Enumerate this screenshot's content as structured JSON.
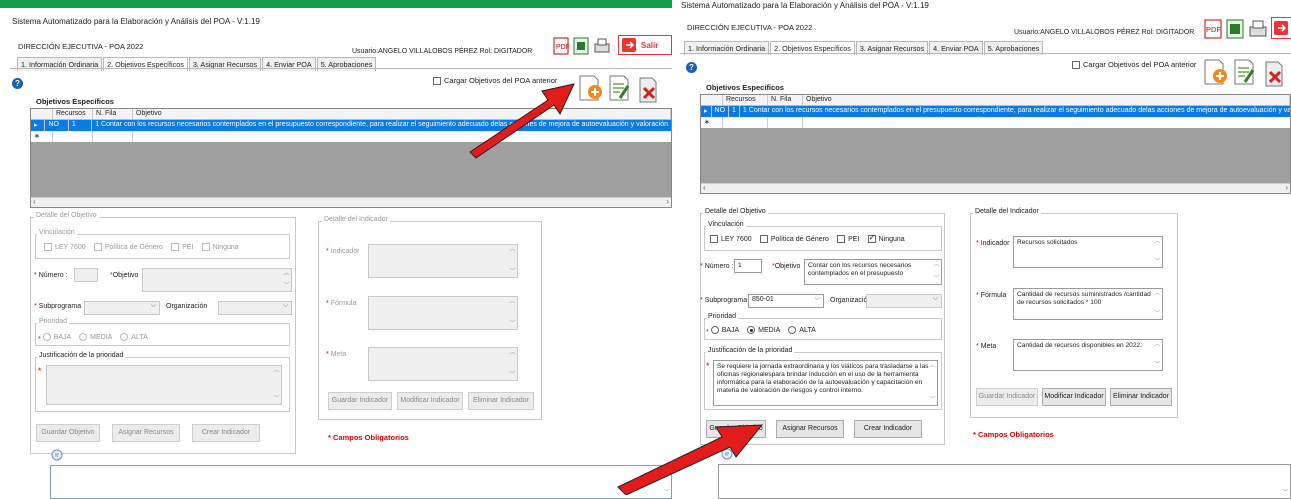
{
  "window_title": "Sistema Automatizado para la Elaboración y Análisis del POA -  V:1.19",
  "header": {
    "direccion": "DIRECCIÓN EJECUTIVA - POA 2022",
    "usuario": "Usuario:ANGELO VILLALOBOS PÉREZ  Rol: DIGITADOR",
    "salir": "Salir"
  },
  "tabs": [
    "1. Información Ordinaria",
    "2. Objetivos Específicos",
    "3. Asignar Recursos",
    "4. Enviar POA",
    "5. Aprobaciones"
  ],
  "cargar_label": "Cargar Objetivos del POA anterior",
  "objetivos_title": "Objetivos Específicos",
  "grid": {
    "columns": [
      "Recursos",
      "N. Fila",
      "Objetivo"
    ],
    "row": {
      "recursos": "NO",
      "fila": "1",
      "objetivo": "1 Contar con los recursos necesarios contemplados en el presupuesto correspondiente, para realizar el seguimiento adecuado delas acciones de mejora de autoevaluación y valoración"
    }
  },
  "detalle_objetivo": {
    "legend": "Detalle del Objetivo",
    "vinculacion": "Vinculación",
    "options": [
      "LEY 7600",
      "Política de Género",
      "PEI",
      "Ninguna"
    ],
    "numero_label": "Número :",
    "objetivo_label": "Objetivo",
    "subprograma_label": "Subprograma",
    "organizacion_label": "Organización",
    "prioridad_legend": "Prioridad",
    "prioridades": [
      "BAJA",
      "MEDIA",
      "ALTA"
    ],
    "justificacion_legend": "Justificación de la prioridad"
  },
  "detalle_indicador": {
    "legend": "Detalle del Indicador",
    "indicador_label": "Indicador",
    "formula_label": "Fórmula",
    "meta_label": "Meta"
  },
  "buttons": {
    "guardar_indicador": "Guardar Indicador",
    "modificar_indicador": "Modificar Indicador",
    "eliminar_indicador": "Eliminar Indicador",
    "guardar_objetivo": "Guardar Objetivo",
    "asignar_recursos": "Asignar Recursos",
    "crear_indicador": "Crear Indicador"
  },
  "campos_obligatorios": "* Campos Obligatorios",
  "right_values": {
    "numero": "1",
    "objetivo": "Contar con los recursos necesarios contemplados en el presupuesto",
    "subprograma": "850-01",
    "justificacion": "Se requiere la jornada extraordinaria y los viáticos para trasladarse a las oficinas regionalespara brindar inducción en el uso de la herramienta informática para la elaboración de la autoevaluación y capacitación en materia de valoración de riesgos y control interno.",
    "indicador": "Recursos solicitados",
    "formula": "Cantidad de recursos suministrados /cantidad de recursos solicitados * 100",
    "meta": "Cantidad de recursos disponibles en 2022."
  },
  "colors": {
    "selection": "#0a7ae6",
    "required": "#e00000",
    "arrow": "#e31b1b"
  }
}
